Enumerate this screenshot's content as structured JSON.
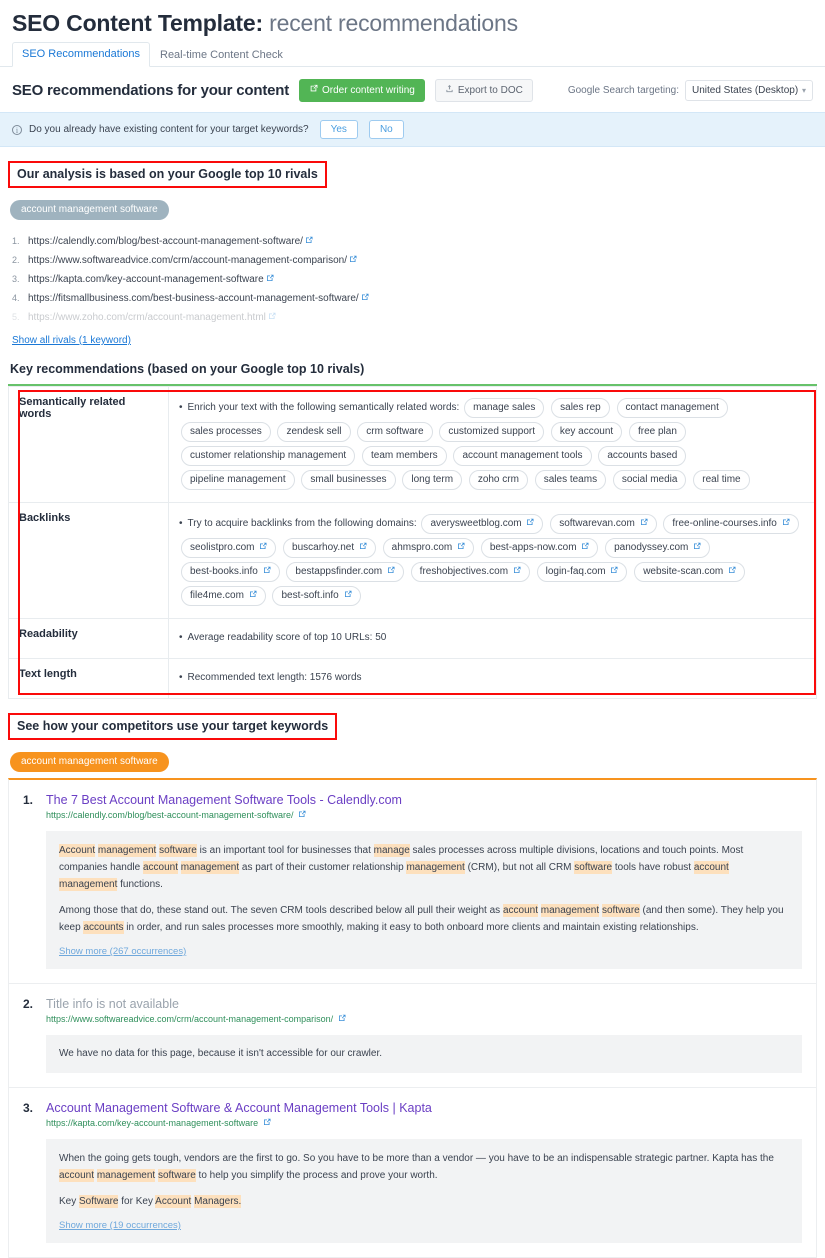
{
  "header": {
    "title_main": "SEO Content Template:",
    "title_sub": " recent recommendations"
  },
  "tabs": [
    {
      "label": "SEO Recommendations",
      "active": true
    },
    {
      "label": "Real-time Content Check",
      "active": false
    }
  ],
  "toolbar": {
    "heading": "SEO recommendations for your content",
    "order_button": "Order content writing",
    "export_button": "Export to DOC",
    "targeting_label": "Google Search targeting:",
    "targeting_value": "United States (Desktop)"
  },
  "banner": {
    "question": "Do you already have existing content for your target keywords?",
    "yes": "Yes",
    "no": "No"
  },
  "rivals_section": {
    "heading": "Our analysis is based on your Google top 10 rivals",
    "keyword_badge": "account management software",
    "urls": [
      {
        "url": "https://calendly.com/blog/best-account-management-software/",
        "faded": false
      },
      {
        "url": "https://www.softwareadvice.com/crm/account-management-comparison/",
        "faded": false
      },
      {
        "url": "https://kapta.com/key-account-management-software",
        "faded": false
      },
      {
        "url": "https://fitsmallbusiness.com/best-business-account-management-software/",
        "faded": false
      },
      {
        "url": "https://www.zoho.com/crm/account-management.html",
        "faded": true
      }
    ],
    "show_all_link": "Show all rivals (1 keyword)"
  },
  "key_recommendations": {
    "heading": "Key recommendations (based on your Google top 10 rivals)",
    "rows": [
      {
        "label": "Semantically related words",
        "lead": "Enrich your text with the following semantically related words:",
        "chips": [
          "manage sales",
          "sales rep",
          "contact management",
          "sales processes",
          "zendesk sell",
          "crm software",
          "customized support",
          "key account",
          "free plan",
          "customer relationship management",
          "team members",
          "account management tools",
          "accounts based",
          "pipeline management",
          "small businesses",
          "long term",
          "zoho crm",
          "sales teams",
          "social media",
          "real time"
        ],
        "chip_ext_icon": false
      },
      {
        "label": "Backlinks",
        "lead": "Try to acquire backlinks from the following domains:",
        "chips": [
          "averysweetblog.com",
          "softwarevan.com",
          "free-online-courses.info",
          "seolistpro.com",
          "buscarhoy.net",
          "ahmspro.com",
          "best-apps-now.com",
          "panodyssey.com",
          "best-books.info",
          "bestappsfinder.com",
          "freshobjectives.com",
          "login-faq.com",
          "website-scan.com",
          "file4me.com",
          "best-soft.info"
        ],
        "chip_ext_icon": true
      },
      {
        "label": "Readability",
        "lead": "Average readability score of top 10 URLs:  50",
        "chips": [],
        "chip_ext_icon": false
      },
      {
        "label": "Text length",
        "lead": "Recommended text length: 1576 words",
        "chips": [],
        "chip_ext_icon": false
      }
    ]
  },
  "competitors_section": {
    "heading": "See how your competitors use your target keywords",
    "keyword_badge": "account management software",
    "items": [
      {
        "num": "1.",
        "title": "The 7 Best Account Management Software Tools - Calendly.com",
        "title_available": true,
        "url": "https://calendly.com/blog/best-account-management-software/",
        "paragraphs": [
          [
            {
              "t": "Account",
              "h": true
            },
            {
              "t": " ",
              "h": false
            },
            {
              "t": "management",
              "h": true
            },
            {
              "t": " ",
              "h": false
            },
            {
              "t": "software",
              "h": true
            },
            {
              "t": " is an important tool for businesses that ",
              "h": false
            },
            {
              "t": "manage",
              "h": true
            },
            {
              "t": " sales processes across multiple divisions, locations and touch points. Most companies handle ",
              "h": false
            },
            {
              "t": "account",
              "h": true
            },
            {
              "t": " ",
              "h": false
            },
            {
              "t": "management",
              "h": true
            },
            {
              "t": " as part of their customer relationship ",
              "h": false
            },
            {
              "t": "management",
              "h": true
            },
            {
              "t": " (CRM), but not all CRM ",
              "h": false
            },
            {
              "t": "software",
              "h": true
            },
            {
              "t": " tools have robust ",
              "h": false
            },
            {
              "t": "account",
              "h": true
            },
            {
              "t": " ",
              "h": false
            },
            {
              "t": "management",
              "h": true
            },
            {
              "t": " functions.",
              "h": false
            }
          ],
          [
            {
              "t": "Among those that do, these stand out. The seven CRM tools described below all pull their weight as ",
              "h": false
            },
            {
              "t": "account",
              "h": true
            },
            {
              "t": " ",
              "h": false
            },
            {
              "t": "management",
              "h": true
            },
            {
              "t": " ",
              "h": false
            },
            {
              "t": "software",
              "h": true
            },
            {
              "t": " (and then some). They help you keep ",
              "h": false
            },
            {
              "t": "accounts",
              "h": true
            },
            {
              "t": " in order, and run sales processes more smoothly, making it easy to both onboard more clients and maintain existing relationships.",
              "h": false
            }
          ]
        ],
        "show_more": "Show more (267 occurrences)",
        "no_data": ""
      },
      {
        "num": "2.",
        "title": "Title info is not available",
        "title_available": false,
        "url": "https://www.softwareadvice.com/crm/account-management-comparison/",
        "paragraphs": [],
        "show_more": "",
        "no_data": "We have no data for this page, because it isn't accessible for our crawler."
      },
      {
        "num": "3.",
        "title": "Account Management Software & Account Management Tools | Kapta",
        "title_available": true,
        "url": "https://kapta.com/key-account-management-software",
        "paragraphs": [
          [
            {
              "t": "When the going gets tough, vendors are the first to go. So you have to be more than a vendor — you have to be an indispensable strategic partner. Kapta has the ",
              "h": false
            },
            {
              "t": "account",
              "h": true
            },
            {
              "t": " ",
              "h": false
            },
            {
              "t": "management",
              "h": true
            },
            {
              "t": " ",
              "h": false
            },
            {
              "t": "software",
              "h": true
            },
            {
              "t": " to help you simplify the process and prove your worth.",
              "h": false
            }
          ],
          [
            {
              "t": "Key ",
              "h": false
            },
            {
              "t": "Software",
              "h": true
            },
            {
              "t": " for Key ",
              "h": false
            },
            {
              "t": "Account",
              "h": true
            },
            {
              "t": " ",
              "h": false
            },
            {
              "t": "Managers.",
              "h": true
            }
          ]
        ],
        "show_more": "Show more (19 occurrences)",
        "no_data": ""
      }
    ]
  },
  "colors": {
    "green_button": "#52b555",
    "orange_accent": "#f7931e",
    "green_accent": "#67c26a",
    "red_annotation": "#fa0a0a",
    "link_blue": "#1a78d6",
    "highlight": "#fde0bd"
  }
}
